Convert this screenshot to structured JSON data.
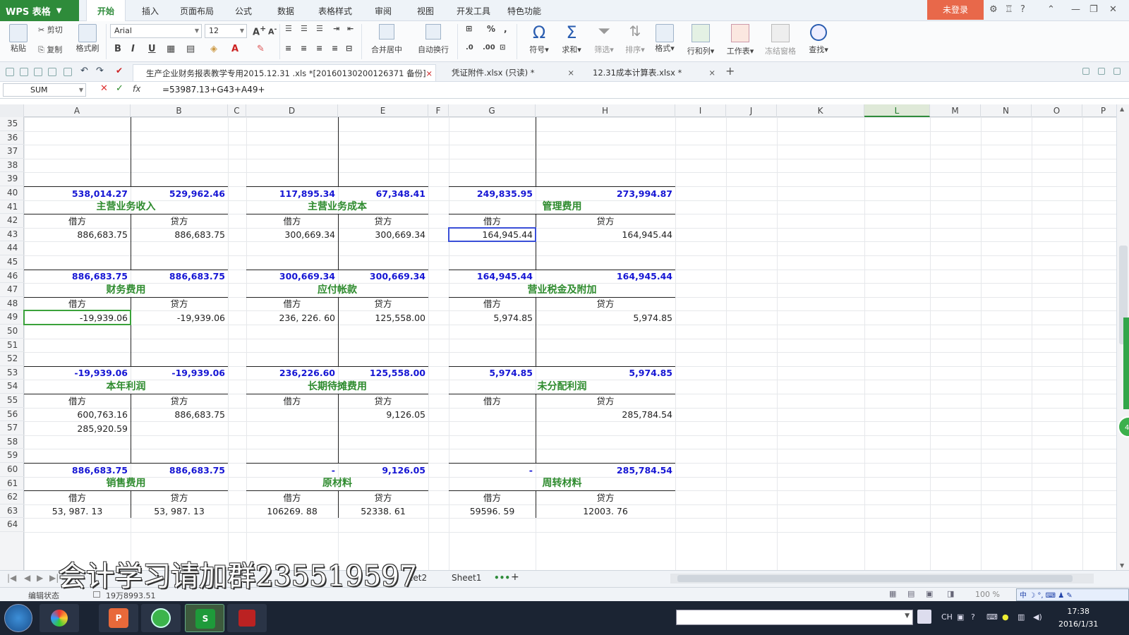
{
  "app": {
    "name": "WPS 表格",
    "login": "未登录"
  },
  "menu_tabs": [
    "开始",
    "插入",
    "页面布局",
    "公式",
    "数据",
    "表格样式",
    "审阅",
    "视图",
    "开发工具",
    "特色功能"
  ],
  "ribbon": {
    "paste": "粘贴",
    "cut": "剪切",
    "copy": "复制",
    "format_painter": "格式刷",
    "font": "Arial",
    "size": "12",
    "merge": "合并居中",
    "wrap": "自动换行",
    "symbol": "符号",
    "sum": "求和",
    "filter": "筛选",
    "sort": "排序",
    "format": "格式",
    "rowcol": "行和列",
    "worksheet": "工作表",
    "freeze": "冻结窗格",
    "find": "查找"
  },
  "doc_tabs": [
    {
      "label": "生产企业财务报表教学专用2015.12.31 .xls *[20160130200126371 备份]",
      "close": "×"
    },
    {
      "label": "凭证附件.xlsx (只读) *",
      "close": "×"
    },
    {
      "label": "12.31成本计算表.xlsx *",
      "close": "×"
    }
  ],
  "formula_bar": {
    "name_box": "SUM",
    "formula": "=53987.13+G43+A49+",
    "fx": "fx"
  },
  "columns": [
    "A",
    "B",
    "C",
    "D",
    "E",
    "F",
    "G",
    "H",
    "I",
    "J",
    "K",
    "L",
    "M",
    "N",
    "O",
    "P"
  ],
  "rows": [
    "35",
    "36",
    "37",
    "38",
    "39",
    "40",
    "41",
    "42",
    "43",
    "44",
    "45",
    "46",
    "47",
    "48",
    "49",
    "50",
    "51",
    "52",
    "53",
    "54",
    "55",
    "56",
    "57",
    "58",
    "59",
    "60",
    "61",
    "62",
    "63",
    "64"
  ],
  "accounts": {
    "r40": [
      "538,014.27",
      "529,962.46",
      "117,895.34",
      "67,348.41",
      "249,835.95",
      "273,994.87"
    ],
    "block1": {
      "titles": [
        "主营业务收入",
        "主营业务成本",
        "管理费用"
      ],
      "debit": "借方",
      "credit": "贷方",
      "r43": [
        "886,683.75",
        "886,683.75",
        "300,669.34",
        "300,669.34",
        "164,945.44",
        "164,945.44"
      ],
      "r46": [
        "886,683.75",
        "886,683.75",
        "300,669.34",
        "300,669.34",
        "164,945.44",
        "164,945.44"
      ]
    },
    "block2": {
      "titles": [
        "财务费用",
        "应付帐款",
        "营业税金及附加"
      ],
      "r49": [
        "-19,939.06",
        "-19,939.06",
        "236, 226. 60",
        "125,558.00",
        "5,974.85",
        "5,974.85"
      ],
      "r53": [
        "-19,939.06",
        "-19,939.06",
        "236,226.60",
        "125,558.00",
        "5,974.85",
        "5,974.85"
      ]
    },
    "block3": {
      "titles": [
        "本年利润",
        "长期待摊费用",
        "未分配利润"
      ],
      "r56": [
        "600,763.16",
        "886,683.75",
        "9,126.05",
        "285,784.54"
      ],
      "r57": [
        "285,920.59"
      ],
      "r60": [
        "886,683.75",
        "886,683.75",
        "-",
        "9,126.05",
        "-",
        "285,784.54"
      ]
    },
    "block4": {
      "titles": [
        "销售费用",
        "原材料",
        "周转材料"
      ],
      "r63": [
        "53, 987. 13",
        "53, 987. 13",
        "106269. 88",
        "52338. 61",
        "59596. 59",
        "12003. 76"
      ]
    }
  },
  "sheet_tabs": [
    "eet2",
    "Sheet1"
  ],
  "status": {
    "mode": "编辑状态",
    "sum": "19万8993.51",
    "zoom": "100 %"
  },
  "taskbar": {
    "time": "17:38",
    "date": "2016/1/31",
    "lang": "CH"
  },
  "watermark": "会计学习请加群235519597",
  "float_badge": "48"
}
